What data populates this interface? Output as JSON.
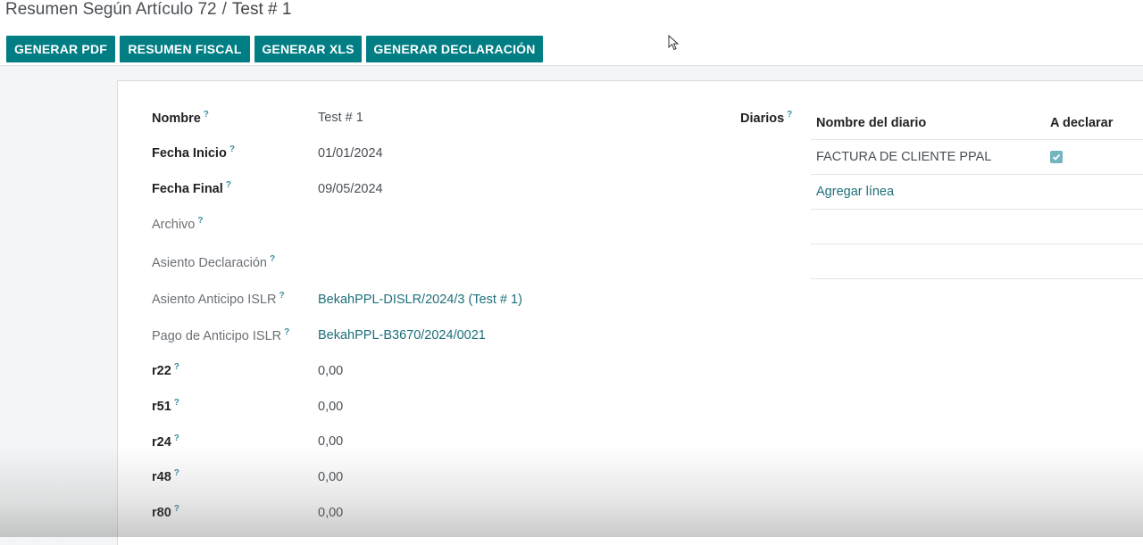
{
  "breadcrumb": {
    "parent": "Resumen Según Artículo 72",
    "separator": "/",
    "current": "Test # 1"
  },
  "actions": {
    "generar_pdf": "GENERAR PDF",
    "resumen_fiscal": "RESUMEN FISCAL",
    "generar_xls": "GENERAR XLS",
    "generar_declaracion": "GENERAR DECLARACIÓN"
  },
  "form": {
    "help_mark": "?",
    "fields": [
      {
        "label": "Nombre",
        "value": "Test # 1"
      },
      {
        "label": "Fecha Inicio",
        "value": "01/01/2024"
      },
      {
        "label": "Fecha Final",
        "value": "09/05/2024"
      },
      {
        "label": "Archivo",
        "value": ""
      },
      {
        "label": "Asiento Declaración",
        "value": ""
      },
      {
        "label": "Asiento Anticipo ISLR",
        "value": "BekahPPL-DISLR/2024/3 (Test # 1)"
      },
      {
        "label": "Pago de Anticipo ISLR",
        "value": "BekahPPL-B3670/2024/0021"
      },
      {
        "label": "r22",
        "value": "0,00"
      },
      {
        "label": "r51",
        "value": "0,00"
      },
      {
        "label": "r24",
        "value": "0,00"
      },
      {
        "label": "r48",
        "value": "0,00"
      },
      {
        "label": "r80",
        "value": "0,00"
      }
    ]
  },
  "diarios": {
    "label": "Diarios",
    "columns": {
      "name": "Nombre del diario",
      "declare": "A declarar"
    },
    "rows": [
      {
        "name": "FACTURA DE CLIENTE PPAL",
        "declare": true
      }
    ],
    "add_line": "Agregar línea"
  },
  "colors": {
    "primary": "#017e84",
    "link": "#1d6f7a",
    "checkbox": "#73b5bd"
  }
}
